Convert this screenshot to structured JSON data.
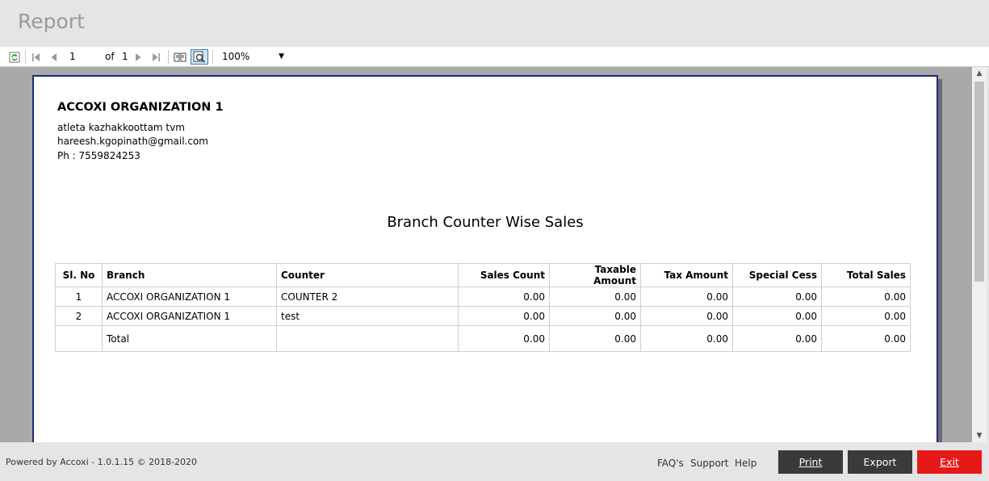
{
  "window": {
    "title": "Report"
  },
  "toolbar": {
    "page_current": "1",
    "page_of_label": "of",
    "page_total": "1",
    "zoom": "100%"
  },
  "report": {
    "org_name": "ACCOXI ORGANIZATION 1",
    "address": "atleta kazhakkoottam tvm",
    "email": "hareesh.kgopinath@gmail.com",
    "phone": "Ph : 7559824253",
    "title": "Branch Counter Wise Sales",
    "columns": [
      "Sl. No",
      "Branch",
      "Counter",
      "Sales Count",
      "Taxable Amount",
      "Tax Amount",
      "Special Cess",
      "Total Sales"
    ],
    "rows": [
      [
        "1",
        "ACCOXI ORGANIZATION 1",
        "COUNTER 2",
        "0.00",
        "0.00",
        "0.00",
        "0.00",
        "0.00"
      ],
      [
        "2",
        "ACCOXI ORGANIZATION 1",
        "test",
        "0.00",
        "0.00",
        "0.00",
        "0.00",
        "0.00"
      ]
    ],
    "total": [
      "",
      "Total",
      "",
      "0.00",
      "0.00",
      "0.00",
      "0.00",
      "0.00"
    ]
  },
  "footer": {
    "powered": "Powered by Accoxi - 1.0.1.15 © 2018-2020",
    "faq": "FAQ's",
    "support": "Support",
    "help": "Help",
    "print": "Print",
    "export": "Export",
    "exit": "Exit"
  },
  "colors": {
    "exit": "#e61919",
    "dark_button": "#3a3a3a",
    "page_border": "#1e2a78"
  }
}
